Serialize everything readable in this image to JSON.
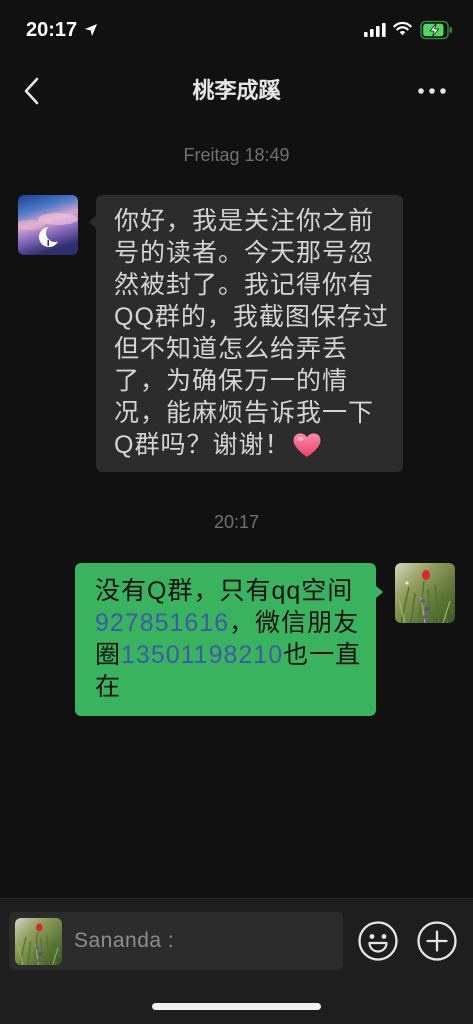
{
  "status_bar": {
    "time": "20:17",
    "location_icon": "location-arrow-icon",
    "signal_icon": "cellular-signal-icon",
    "wifi_icon": "wifi-icon",
    "battery_icon": "battery-charging-icon",
    "battery_level": 0.9
  },
  "colors": {
    "background": "#111111",
    "incoming_bubble": "#2c2c2c",
    "outgoing_bubble": "#3ab35f",
    "link": "#3d5ca6",
    "battery": "#4cd964"
  },
  "nav": {
    "back_icon": "chevron-left-icon",
    "title": "桃李成蹊",
    "more_icon": "more-dots-icon"
  },
  "chat": {
    "first_timestamp": "Freitag 18:49",
    "incoming_message": {
      "avatar_icon": "moon-sky-avatar-icon",
      "text": "你好，我是关注你之前号的读者。今天那号忽然被封了。我记得你有QQ群的，我截图保存过但不知道怎么给弄丢了，为确保万一的情况，能麻烦告诉我一下Q群吗？谢谢！",
      "emoji_icon": "heart-emoji-icon"
    },
    "second_timestamp": "20:17",
    "outgoing_message": {
      "avatar_icon": "flower-avatar-icon",
      "segments": [
        {
          "text": "没有Q群，只有qq空间",
          "is_link": false
        },
        {
          "text": "927851616",
          "is_link": true
        },
        {
          "text": "，微信朋友圈",
          "is_link": false
        },
        {
          "text": "13501198210",
          "is_link": true
        },
        {
          "text": "也一直在",
          "is_link": false
        }
      ]
    }
  },
  "input_bar": {
    "avatar_icon": "flower-avatar-icon",
    "sender_label": "Sananda :",
    "emoji_icon": "smiley-face-icon",
    "plus_icon": "plus-circle-icon"
  }
}
